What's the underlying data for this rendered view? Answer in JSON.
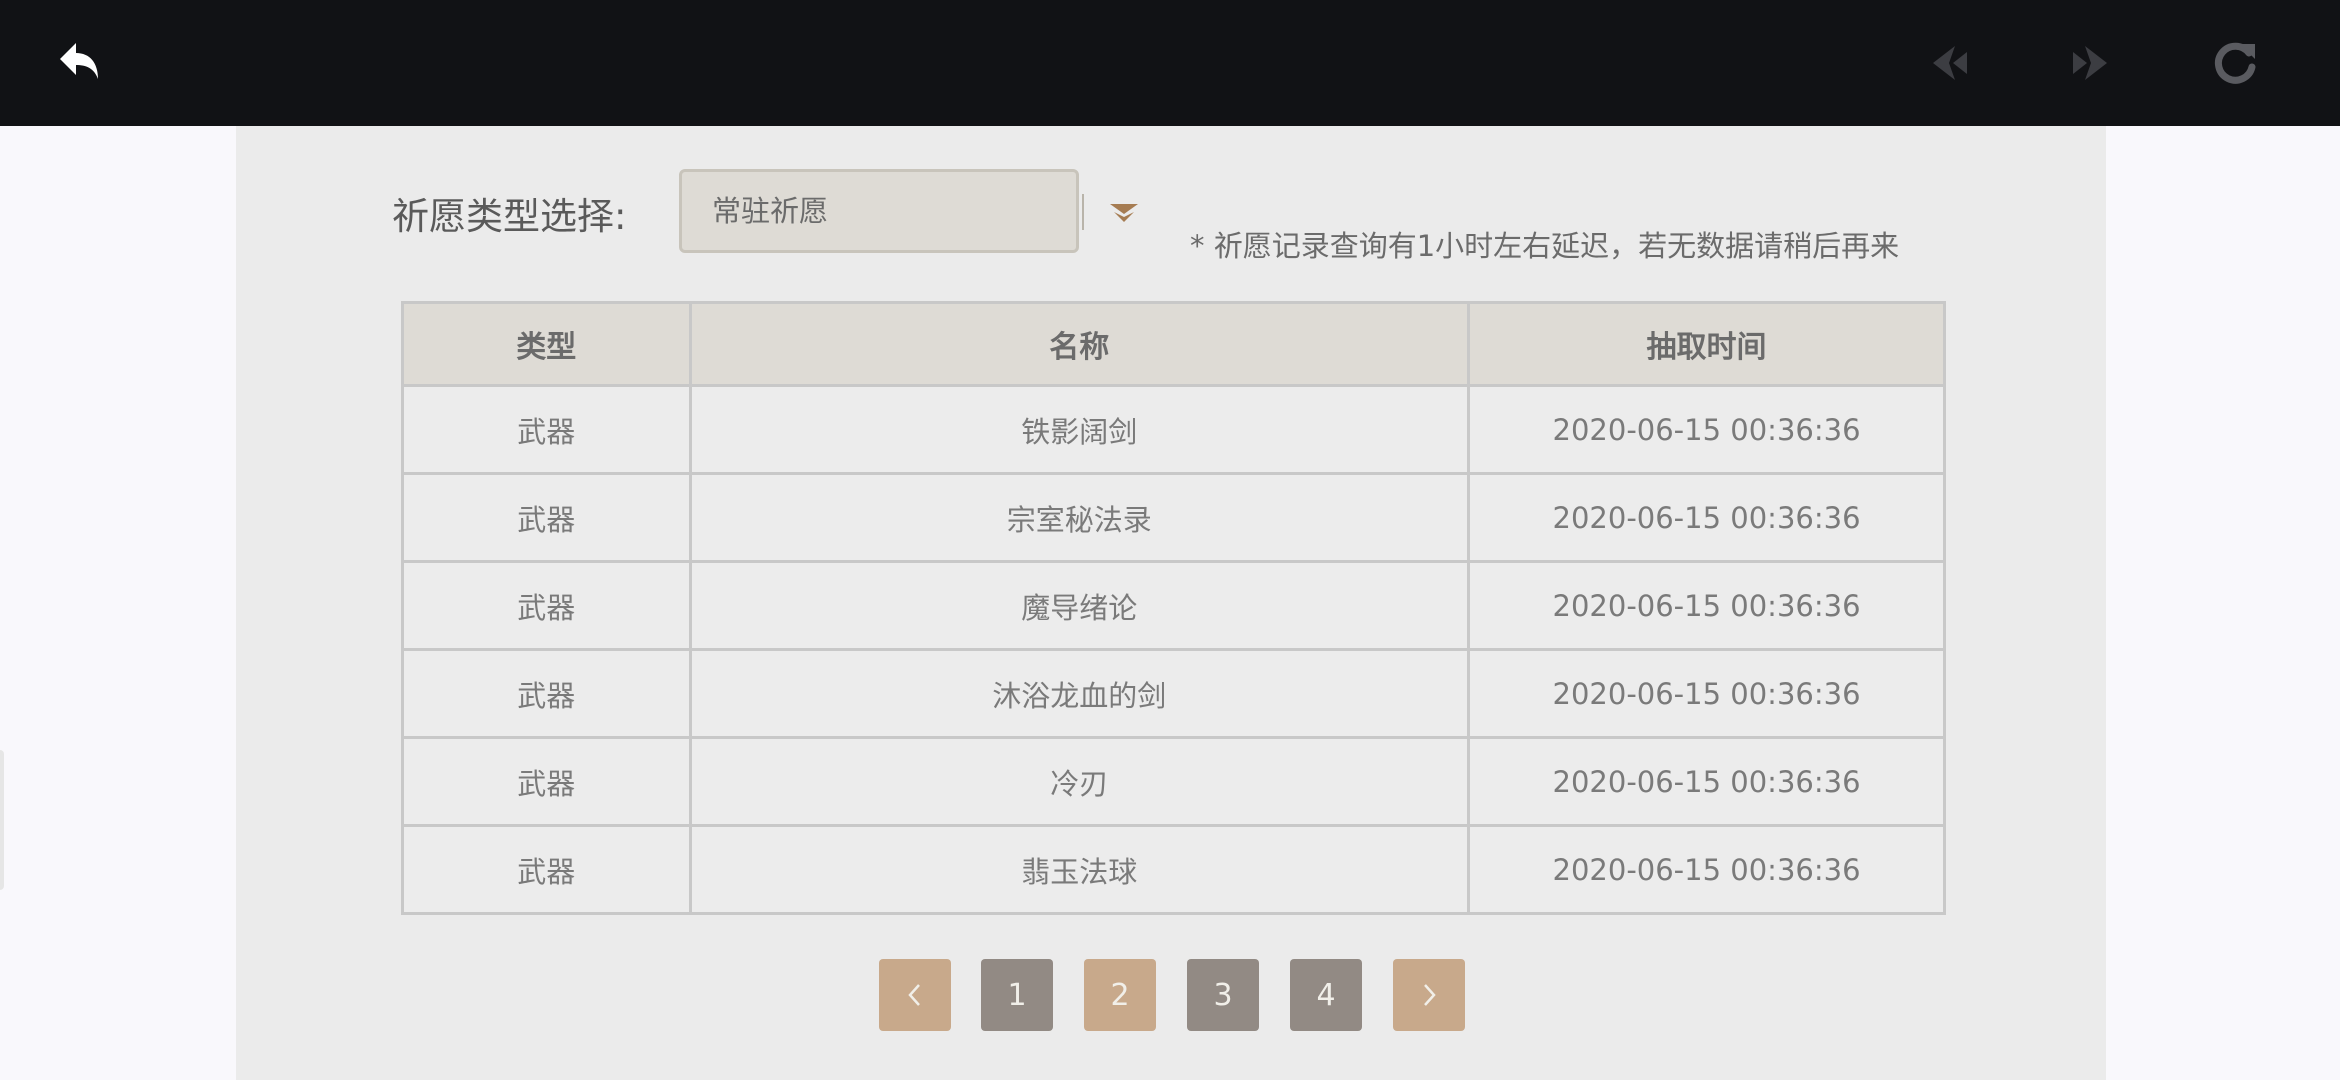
{
  "filter": {
    "label": "祈愿类型选择:",
    "selected": "常驻祈愿",
    "notice": "* 祈愿记录查询有1小时左右延迟，若无数据请稍后再来"
  },
  "table": {
    "headers": [
      "类型",
      "名称",
      "抽取时间"
    ],
    "rows": [
      [
        "武器",
        "铁影阔剑",
        "2020-06-15 00:36:36"
      ],
      [
        "武器",
        "宗室秘法录",
        "2020-06-15 00:36:36"
      ],
      [
        "武器",
        "魔导绪论",
        "2020-06-15 00:36:36"
      ],
      [
        "武器",
        "沐浴龙血的剑",
        "2020-06-15 00:36:36"
      ],
      [
        "武器",
        "冷刃",
        "2020-06-15 00:36:36"
      ],
      [
        "武器",
        "翡玉法球",
        "2020-06-15 00:36:36"
      ]
    ]
  },
  "pagination": {
    "pages": [
      "1",
      "2",
      "3",
      "4"
    ],
    "current_page": "2",
    "prev_icon": "chevron-left-icon",
    "next_icon": "chevron-right-icon"
  },
  "toolbar": {
    "icons": [
      "back-icon",
      "prev-page-icon",
      "next-page-icon",
      "reload-icon"
    ]
  },
  "colors": {
    "topbar": "#111215",
    "panel": "#ebebeb",
    "header_cell": "#dedbd5",
    "accent_gold": "#c8a98b",
    "page_gray": "#928a84",
    "select_arrow": "#a67c52"
  }
}
